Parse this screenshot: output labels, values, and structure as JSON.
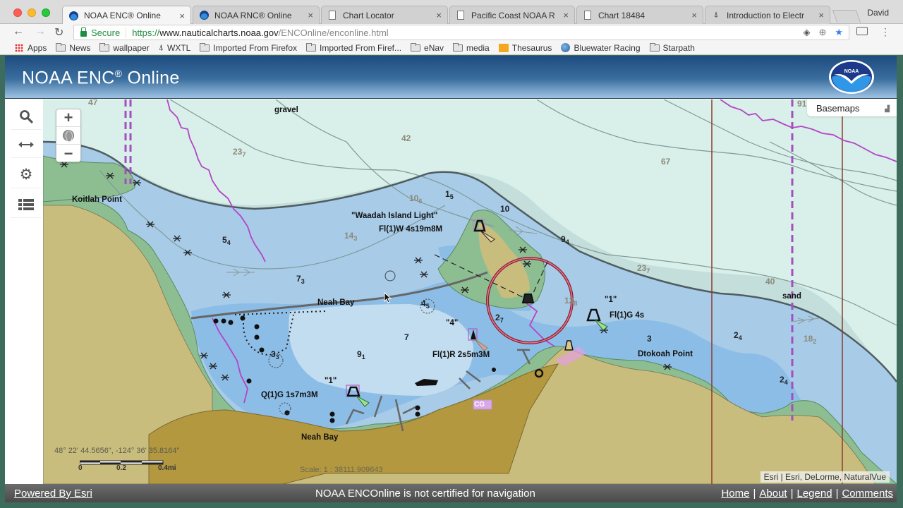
{
  "browser": {
    "tabs": [
      {
        "label": "NOAA ENC® Online",
        "icon": "noaa-icon",
        "active": true
      },
      {
        "label": "NOAA RNC® Online",
        "icon": "noaa-icon",
        "active": false
      },
      {
        "label": "Chart Locator",
        "icon": "page-icon",
        "active": false
      },
      {
        "label": "Pacific Coast NOAA R",
        "icon": "page-icon",
        "active": false
      },
      {
        "label": "Chart 18484",
        "icon": "page-icon",
        "active": false
      },
      {
        "label": "Introduction to Electr",
        "icon": "lighthouse-icon",
        "active": false
      }
    ],
    "profile_name": "David",
    "secure_label": "Secure",
    "url": {
      "scheme": "https://",
      "host": "www.nauticalcharts.noaa.gov",
      "path": "/ENCOnline/enconline.html"
    },
    "bookmarks": [
      {
        "label": "Apps",
        "icon": "apps-grid-icon"
      },
      {
        "label": "News",
        "icon": "folder-icon"
      },
      {
        "label": "wallpaper",
        "icon": "folder-icon"
      },
      {
        "label": "WXTL",
        "icon": "lighthouse-icon"
      },
      {
        "label": "Imported From Firefox",
        "icon": "folder-icon"
      },
      {
        "label": "Imported From Firef...",
        "icon": "folder-icon"
      },
      {
        "label": "eNav",
        "icon": "folder-icon"
      },
      {
        "label": "media",
        "icon": "folder-icon"
      },
      {
        "label": "Thesaurus",
        "icon": "thesaurus-icon"
      },
      {
        "label": "Bluewater Racing",
        "icon": "globe-icon"
      },
      {
        "label": "Starpath",
        "icon": "folder-icon"
      }
    ]
  },
  "app": {
    "title": "NOAA ENC",
    "title_mark": "®",
    "title_suffix": " Online",
    "basemaps_label": "Basemaps",
    "sidebar": [
      {
        "name": "search-icon",
        "glyph": "search"
      },
      {
        "name": "measure-icon",
        "glyph": "⟷"
      },
      {
        "name": "settings-icon",
        "glyph": "⚙"
      },
      {
        "name": "layers-list-icon",
        "glyph": "list"
      }
    ],
    "zoom": {
      "in": "+",
      "out": "−"
    },
    "coordinates": "48° 22' 44.5656\", -124° 36' 35.8164\"",
    "scalebar": {
      "ticks": [
        "0",
        "0.2",
        "0.4mi"
      ]
    },
    "scale": "Scale: 1 : 38111.909643",
    "attribution": "Esri | Esri, DeLorme, NaturalVue"
  },
  "map": {
    "place_labels": [
      {
        "text": "Koitlah Point"
      },
      {
        "text": "Neah Bay"
      },
      {
        "text": "Neah Bay"
      },
      {
        "text": "Dtokoah Point"
      },
      {
        "text": "gravel"
      },
      {
        "text": "sand"
      }
    ],
    "light_labels": [
      {
        "text": "\"Waadah Island Light\""
      },
      {
        "text": "Fl(1)W 4s19m8M"
      },
      {
        "text": "\"1\""
      },
      {
        "text": "Fl(1)G 4s"
      },
      {
        "text": "\"4\""
      },
      {
        "text": "Fl(1)R 2s5m3M"
      },
      {
        "text": "\"1\""
      },
      {
        "text": "Q(1)G 1s7m3M"
      }
    ],
    "soundings": [
      {
        "v": "47",
        "s": "",
        "dark": false
      },
      {
        "v": "23",
        "s": "7",
        "dark": false
      },
      {
        "v": "42",
        "s": "",
        "dark": false
      },
      {
        "v": "67",
        "s": "",
        "dark": false
      },
      {
        "v": "91",
        "s": "",
        "dark": false
      },
      {
        "v": "10",
        "s": "6",
        "dark": false
      },
      {
        "v": "1",
        "s": "5",
        "dark": true
      },
      {
        "v": "10",
        "s": "",
        "dark": true
      },
      {
        "v": "14",
        "s": "3",
        "dark": false
      },
      {
        "v": "5",
        "s": "4",
        "dark": true
      },
      {
        "v": "9",
        "s": "4",
        "dark": true
      },
      {
        "v": "23",
        "s": "7",
        "dark": false
      },
      {
        "v": "7",
        "s": "3",
        "dark": true
      },
      {
        "v": "4",
        "s": "5",
        "dark": true
      },
      {
        "v": "12",
        "s": "8",
        "dark": false
      },
      {
        "v": "40",
        "s": "",
        "dark": false
      },
      {
        "v": "2",
        "s": "7",
        "dark": true
      },
      {
        "v": "7",
        "s": "",
        "dark": true
      },
      {
        "v": "3",
        "s": "",
        "dark": true
      },
      {
        "v": "2",
        "s": "4",
        "dark": true
      },
      {
        "v": "18",
        "s": "2",
        "dark": false
      },
      {
        "v": "9",
        "s": "1",
        "dark": true
      },
      {
        "v": "3",
        "s": "3",
        "dark": true
      },
      {
        "v": "2",
        "s": "4",
        "dark": true
      }
    ],
    "special_labels": [
      {
        "text": "CG"
      }
    ]
  },
  "footer": {
    "powered_by": "Powered By Esri",
    "disclaimer": "NOAA ENCOnline is not certified for navigation",
    "links": [
      "Home",
      "About",
      "Legend",
      "Comments"
    ],
    "separator": "|"
  }
}
